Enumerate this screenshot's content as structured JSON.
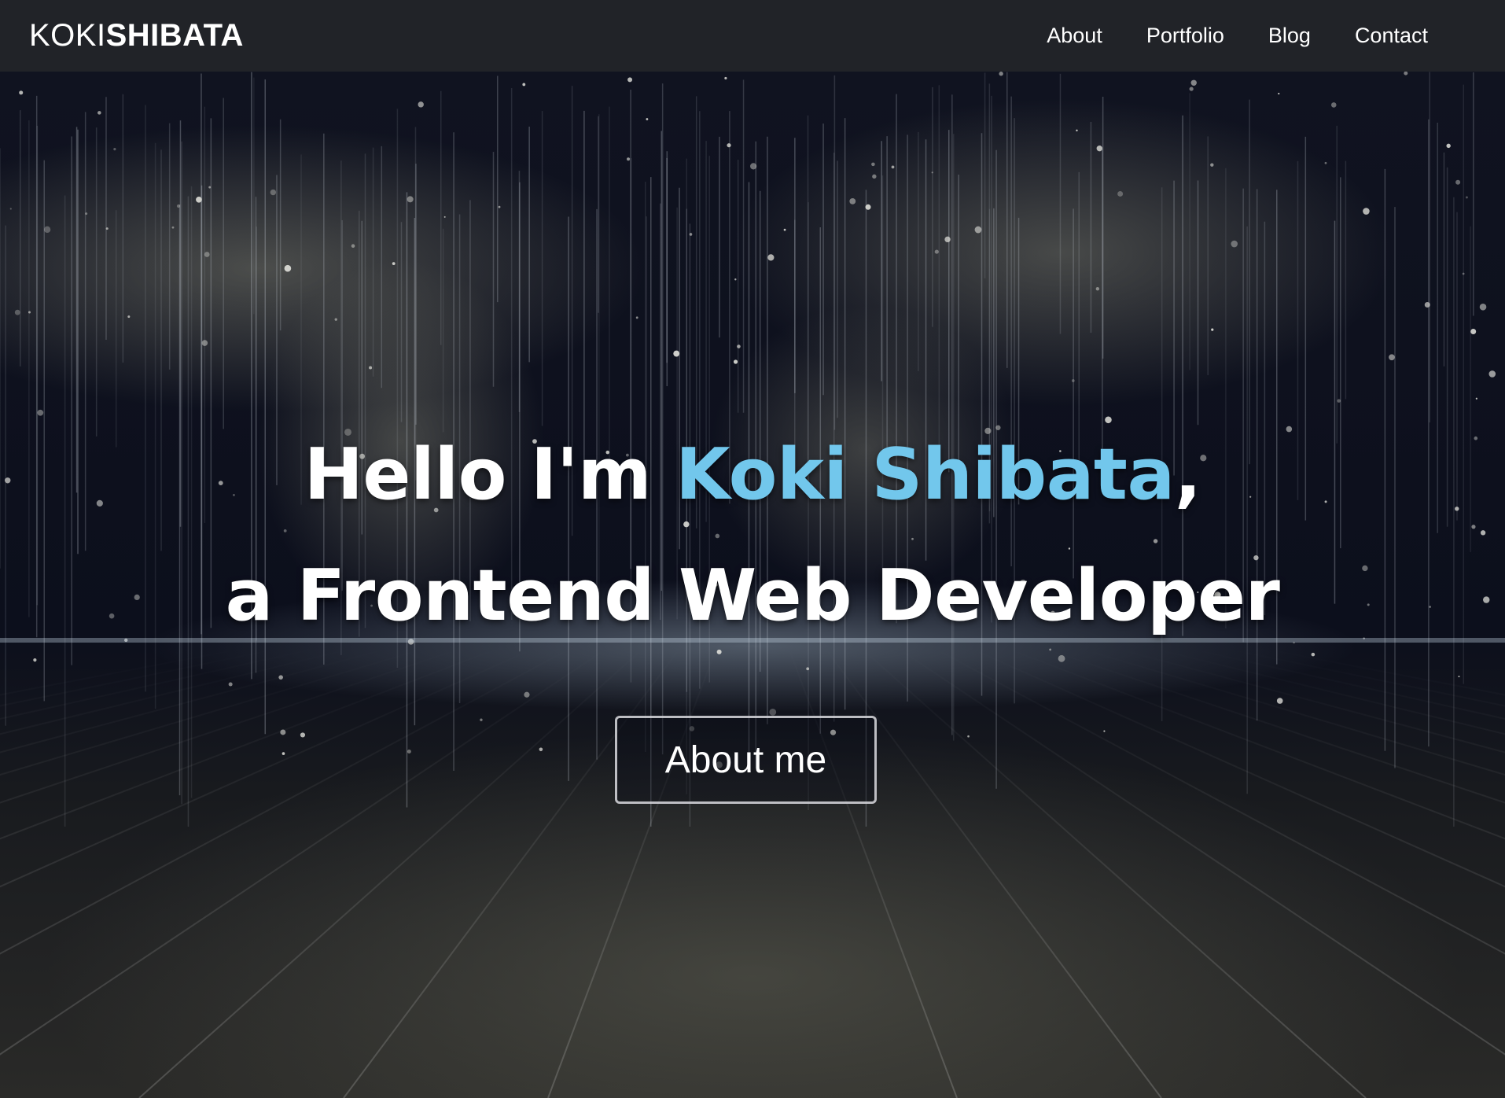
{
  "navbar": {
    "brand_light": "KOKI",
    "brand_bold": "SHIBATA",
    "links": [
      {
        "label": "About"
      },
      {
        "label": "Portfolio"
      },
      {
        "label": "Blog"
      },
      {
        "label": "Contact"
      }
    ]
  },
  "hero": {
    "greeting": "Hello I'm ",
    "name": "Koki Shibata",
    "comma": ",",
    "role_line": "a Frontend Web Developer",
    "cta_label": "About me"
  },
  "colors": {
    "navbar_bg": "#212328",
    "accent": "#72c7ec",
    "text": "#ffffff"
  }
}
